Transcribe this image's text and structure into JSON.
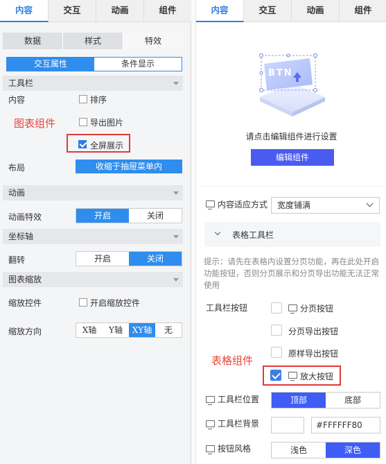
{
  "left": {
    "tabs": [
      "内容",
      "交互",
      "动画",
      "组件"
    ],
    "subtabs": [
      "数据",
      "样式",
      "特效"
    ],
    "subsubtabs": [
      "交互属性",
      "条件显示"
    ],
    "toolbar_section": "工具栏",
    "content_label": "内容",
    "sort_label": "排序",
    "export_image_label": "导出图片",
    "fullscreen_label": "全屏展示",
    "annotation_chart": "图表组件",
    "layout_label": "布局",
    "layout_value": "收缩于抽屉菜单内",
    "animation_section": "动画",
    "animation_effect_label": "动画特效",
    "animation_options": [
      "开启",
      "关闭"
    ],
    "axis_section": "坐标轴",
    "flip_label": "翻转",
    "flip_options": [
      "开启",
      "关闭"
    ],
    "zoom_section": "图表缩放",
    "zoom_control_label": "缩放控件",
    "zoom_control_checkbox": "开启缩放控件",
    "zoom_direction_label": "缩放方向",
    "zoom_direction_options": [
      "X轴",
      "Y轴",
      "XY轴",
      "无"
    ]
  },
  "right": {
    "tabs": [
      "内容",
      "交互",
      "动画",
      "组件"
    ],
    "illustration_text": "BTN",
    "hint": "请点击编辑组件进行设置",
    "edit_button": "编辑组件",
    "fit_label": "内容适应方式",
    "fit_value": "宽度铺满",
    "table_toolbar_section": "表格工具栏",
    "tip": "提示：请先在表格内设置分页功能，再在此处开启功能按钮，否则分页展示和分页导出功能无法正常使用",
    "toolbar_buttons_label": "工具栏按钮",
    "buttons": [
      "分页按钮",
      "分页导出按钮",
      "原样导出按钮",
      "放大按钮"
    ],
    "annotation_table": "表格组件",
    "toolbar_position_label": "工具栏位置",
    "position_options": [
      "顶部",
      "底部"
    ],
    "toolbar_bg_label": "工具栏背景",
    "bg_value": "#FFFFFF80",
    "button_style_label": "按钮风格",
    "style_options": [
      "浅色",
      "深色"
    ]
  },
  "colors": {
    "accent": "#2f7de1",
    "primary_button": "#4a5bf0",
    "annotation": "#e8463c"
  }
}
